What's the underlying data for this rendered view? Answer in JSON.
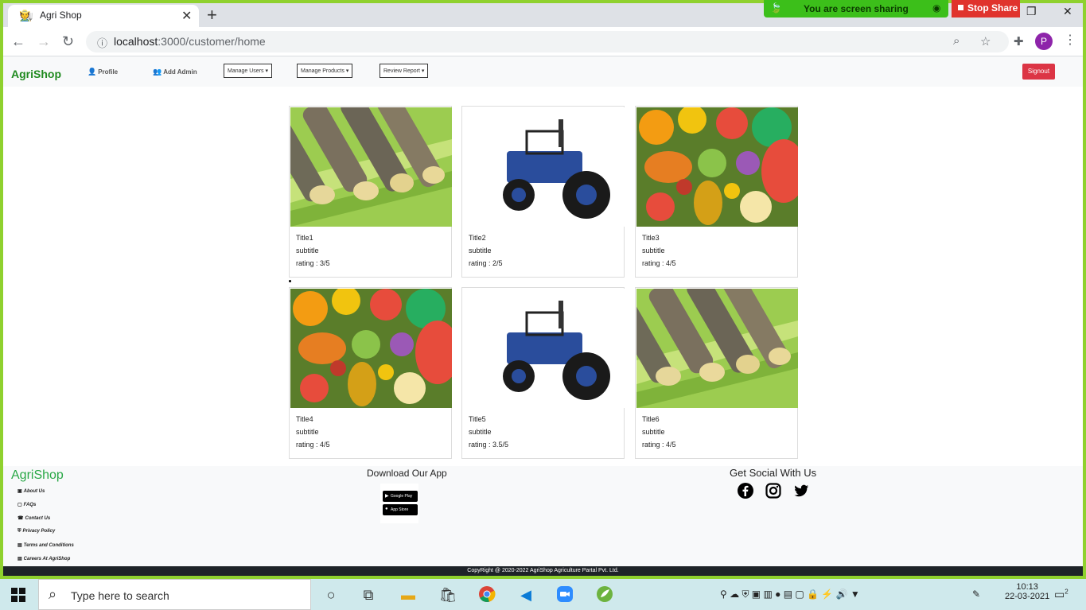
{
  "browser": {
    "tab_title": "Agri Shop",
    "url_host": "localhost",
    "url_rest": ":3000/customer/home",
    "share_notice": "You are screen sharing",
    "stop_share": "Stop Share",
    "avatar_letter": "P"
  },
  "nav": {
    "brand": "AgriShop",
    "profile": "Profile",
    "add_admin": "Add Admin",
    "manage_users": "Manage Users",
    "manage_products": "Manage Products",
    "review_report": "Review Report",
    "signout": "Signout"
  },
  "products": [
    {
      "title": "Title1",
      "subtitle": "subtitle",
      "rating": "rating : 3/5",
      "image": "sugarcane"
    },
    {
      "title": "Title2",
      "subtitle": "subtitle",
      "rating": "rating : 2/5",
      "image": "tractor"
    },
    {
      "title": "Title3",
      "subtitle": "subtitle",
      "rating": "rating : 4/5",
      "image": "fruits"
    },
    {
      "title": "Title4",
      "subtitle": "subtitle",
      "rating": "rating : 4/5",
      "image": "fruits"
    },
    {
      "title": "Title5",
      "subtitle": "subtitle",
      "rating": "rating : 3.5/5",
      "image": "tractor"
    },
    {
      "title": "Title6",
      "subtitle": "subtitle",
      "rating": "rating : 4/5",
      "image": "sugarcane"
    }
  ],
  "footer": {
    "brand": "AgriShop",
    "links": [
      "About Us",
      "FAQs",
      "Contact Us",
      "Privacy Policy",
      "Terms and Conditions",
      "Careers At AgriShop"
    ],
    "download_title": "Download Our App",
    "google_play": "Google Play",
    "app_store": "App Store",
    "social_title": "Get Social With Us",
    "social_icons": [
      "facebook-icon",
      "instagram-icon",
      "twitter-icon"
    ],
    "copyright": "CopyRight @ 2020-2022 AgriShop Agriculture Partal Pvt. Ltd."
  },
  "taskbar": {
    "search_placeholder": "Type here to search",
    "time": "10:13",
    "date": "22-03-2021",
    "notification_count": "2"
  },
  "colors": {
    "accent_green": "#28a745",
    "signout_red": "#dc3545",
    "share_green": "#3cbf1a",
    "stop_red": "#e0332d"
  }
}
